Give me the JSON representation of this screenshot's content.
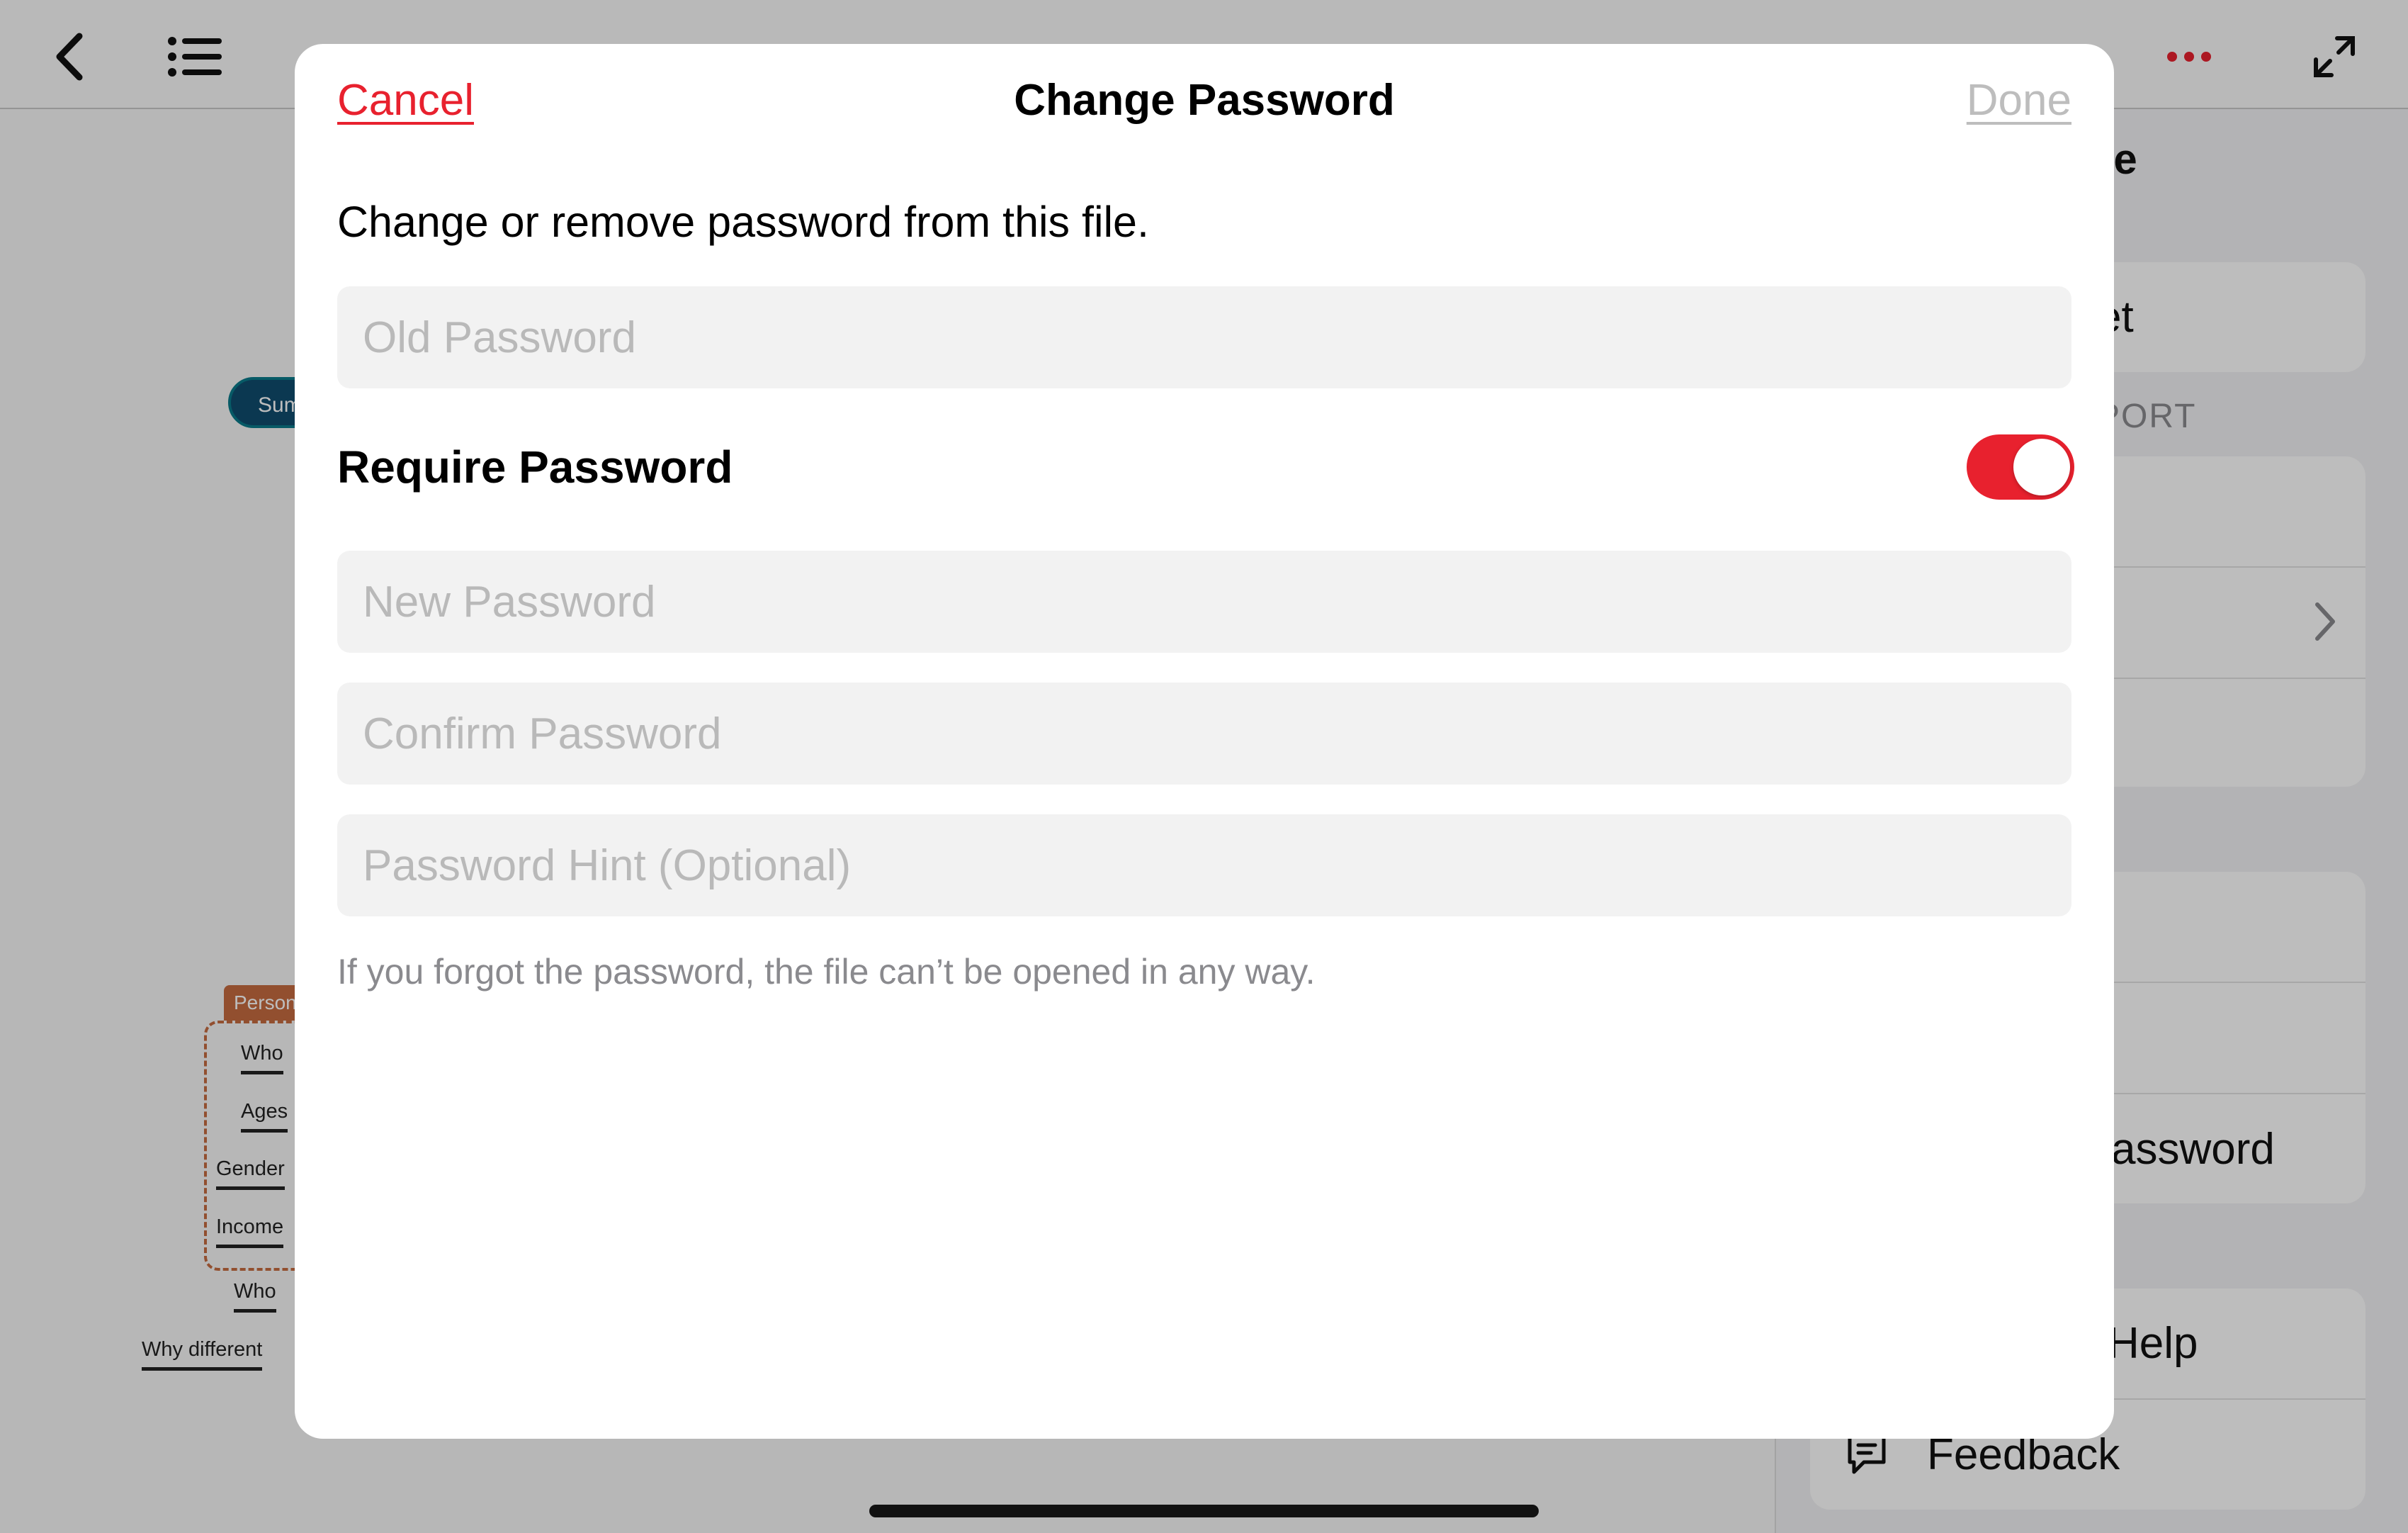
{
  "background": {
    "canvas_nodes": {
      "summary_pill": "Sum",
      "group_header": "Person",
      "group_items": [
        "Who",
        "Ages",
        "Gender",
        "Income"
      ],
      "loose_items": [
        "Who",
        "Why different"
      ]
    },
    "sidebar": {
      "title_fragment": "re",
      "row_1": "et",
      "section_fragment": "PORT",
      "row_password": "assword",
      "row_help": "Help",
      "row_feedback": "Feedback"
    }
  },
  "dialog": {
    "cancel_label": "Cancel",
    "title": "Change Password",
    "done_label": "Done",
    "description": "Change or remove password from this file.",
    "old_password_placeholder": "Old Password",
    "require_password_label": "Require Password",
    "require_password_on": true,
    "new_password_placeholder": "New Password",
    "confirm_password_placeholder": "Confirm Password",
    "hint_placeholder": "Password Hint (Optional)",
    "warning": "If you forgot the password, the file can’t be opened in any way."
  },
  "colors": {
    "accent": "#e8212e",
    "disabled_text": "#bdbdbd",
    "field_bg": "#f2f2f2",
    "secondary_text": "#8a8a8e"
  }
}
